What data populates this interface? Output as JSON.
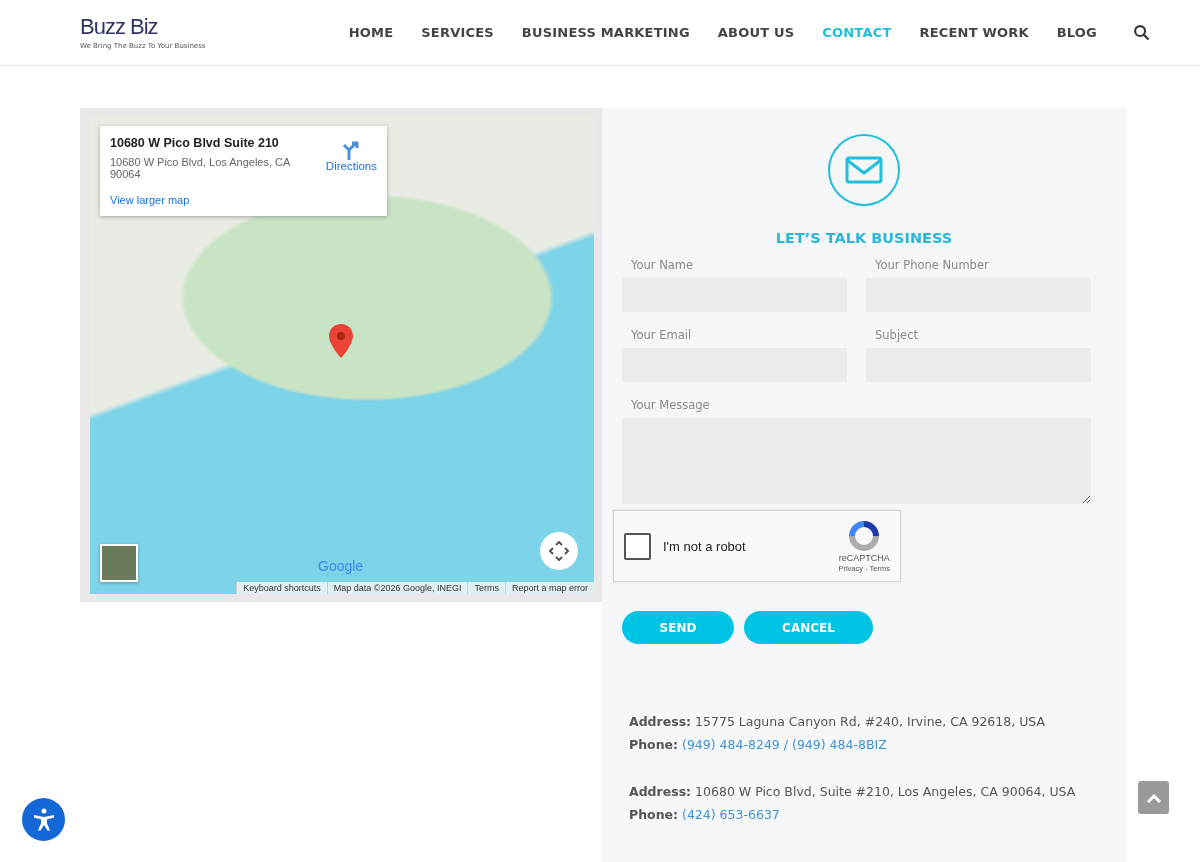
{
  "header": {
    "logo": {
      "name": "Buzz Biz",
      "tagline": "We Bring The Buzz To Your Business"
    },
    "nav": [
      {
        "label": "HOME",
        "selected": false
      },
      {
        "label": "SERVICES",
        "selected": false
      },
      {
        "label": "BUSINESS MARKETING",
        "selected": false
      },
      {
        "label": "ABOUT US",
        "selected": false
      },
      {
        "label": "CONTACT",
        "selected": true
      },
      {
        "label": "RECENT WORK",
        "selected": false
      },
      {
        "label": "BLOG",
        "selected": false
      }
    ]
  },
  "map": {
    "card": {
      "title": "10680 W Pico Blvd Suite 210",
      "address": "10680 W Pico Blvd, Los Angeles, CA 90064",
      "directions": "Directions",
      "larger": "View larger map"
    },
    "logo": "Google",
    "footer": [
      "Keyboard shortcuts",
      "Map data ©2026 Google, INEGI",
      "Terms",
      "Report a map error"
    ]
  },
  "form": {
    "heading": "LET’S TALK BUSINESS",
    "fields": [
      {
        "label": "Your Name",
        "kind": "input"
      },
      {
        "label": "Your Phone Number",
        "kind": "input"
      },
      {
        "label": "Your Email",
        "kind": "input"
      },
      {
        "label": "Subject",
        "kind": "input"
      },
      {
        "label": "Your Message",
        "kind": "textarea"
      }
    ],
    "captcha": {
      "label": "I'm not a robot",
      "checked": false,
      "brand": "reCAPTCHA",
      "links": "Privacy - Terms"
    },
    "buttons": [
      "SEND",
      "CANCEL"
    ]
  },
  "contacts": [
    {
      "address": "**Address:** 15775 Laguna Canyon Rd, #240, Irvine, CA 92618, USA",
      "phone_label": "Phone:",
      "phones": [
        "(949) 484-8249",
        "(949) 484-8BIZ"
      ],
      "separator": "/"
    },
    {
      "address": "**Address:** 10680 W Pico Blvd, Suite #210, Los Angeles, CA 90064, USA",
      "phone_label": "Phone:",
      "phones": [
        "(424) 653-6637"
      ]
    }
  ]
}
